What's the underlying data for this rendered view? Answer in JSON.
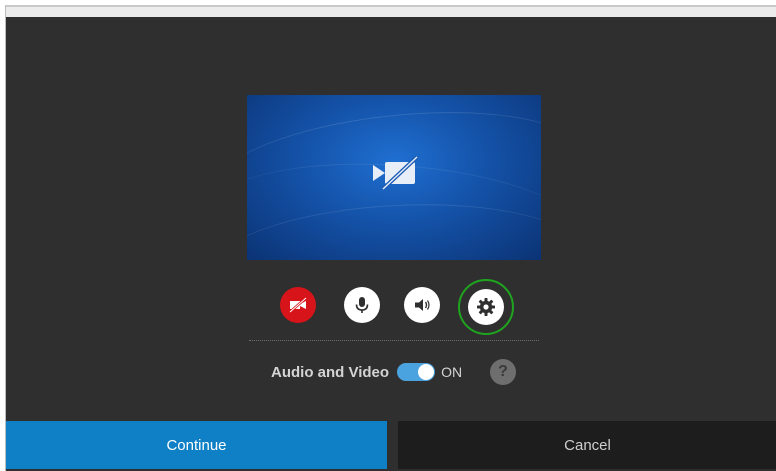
{
  "preview": {
    "icon": "video-off-icon",
    "background_color": "#1452a8"
  },
  "controls": {
    "video": {
      "icon": "video-off-icon",
      "state": "off",
      "color": "#d7141a"
    },
    "mic": {
      "icon": "microphone-icon",
      "state": "on"
    },
    "speaker": {
      "icon": "speaker-icon",
      "state": "on"
    },
    "settings": {
      "icon": "gear-icon",
      "state": "focused",
      "ring_color": "#1fa41f"
    }
  },
  "av_toggle": {
    "label": "Audio and Video",
    "state": "ON",
    "enabled": true,
    "toggle_color": "#4aa3df"
  },
  "help": {
    "label": "?"
  },
  "actions": {
    "continue_label": "Continue",
    "cancel_label": "Cancel",
    "continue_color": "#0f80c5"
  }
}
